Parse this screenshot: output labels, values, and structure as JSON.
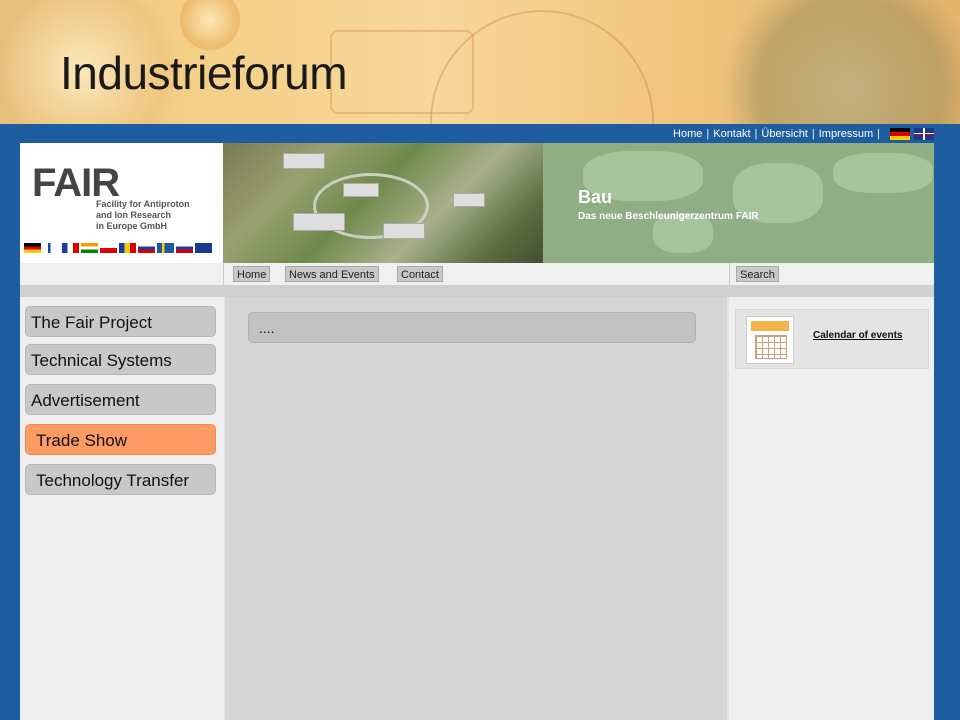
{
  "slide": {
    "title": "Industrieforum"
  },
  "top_menu": {
    "items": [
      "Home",
      "Kontakt",
      "Übersicht",
      "Impressum"
    ],
    "separator": "|"
  },
  "logo": {
    "mark": "FAIR",
    "text": [
      "Facility for Antiproton",
      "and Ion Research",
      "in Europe GmbH"
    ]
  },
  "banner": {
    "title": "Bau",
    "subtitle": "Das neue Beschleunigerzentrum FAIR"
  },
  "nav": {
    "home": "Home",
    "news": "News and Events",
    "contact": "Contact",
    "search": "Search"
  },
  "sidebar": {
    "items": [
      {
        "label": "The Fair Project",
        "active": false
      },
      {
        "label": "Technical Systems",
        "active": false
      },
      {
        "label": "Advertisement",
        "active": false
      },
      {
        "label": "Trade Show",
        "active": true
      },
      {
        "label": "Technology Transfer",
        "active": false
      }
    ]
  },
  "content": {
    "text": "...."
  },
  "right_panel": {
    "calendar_link": "Calendar of events"
  },
  "colors": {
    "frame": "#1e5da0",
    "active_tab": "#fb9a63",
    "button": "#c8c8c8"
  }
}
